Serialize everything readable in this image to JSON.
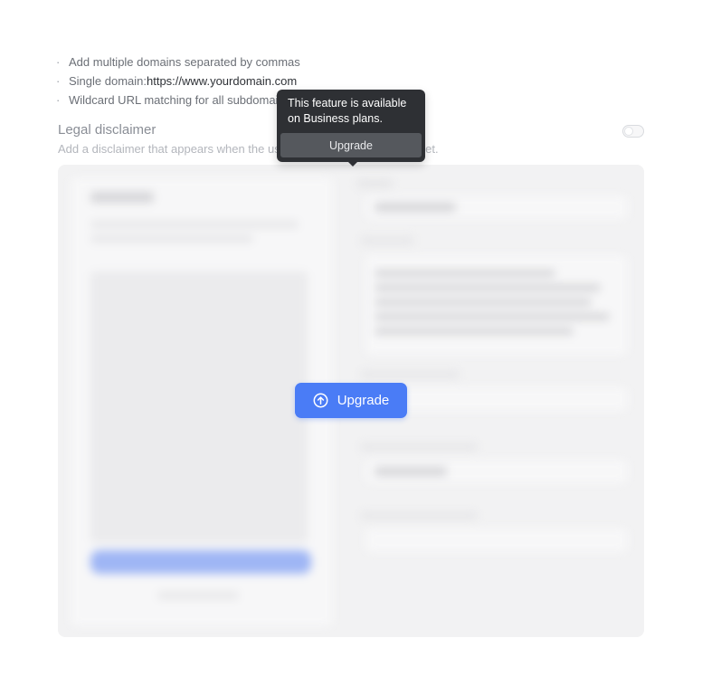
{
  "hints": {
    "items": [
      {
        "text": "Add multiple domains separated by commas",
        "extra": ""
      },
      {
        "text": "Single domain:",
        "extra": "https://www.yourdomain.com"
      },
      {
        "text": "Wildcard URL matching for all subdomain",
        "extra": ""
      }
    ]
  },
  "legal": {
    "title": "Legal disclaimer",
    "desc_start": "Add a disclaimer that appears when the us",
    "desc_end": "dget.",
    "toggle_on": false
  },
  "tooltip": {
    "text": "This feature is available on Business plans.",
    "button_label": "Upgrade"
  },
  "upgrade_cta": {
    "label": "Upgrade",
    "icon": "arrow-up-circle-icon"
  },
  "colors": {
    "accent": "#4a7cf6",
    "tooltip_bg": "#2e3034"
  }
}
